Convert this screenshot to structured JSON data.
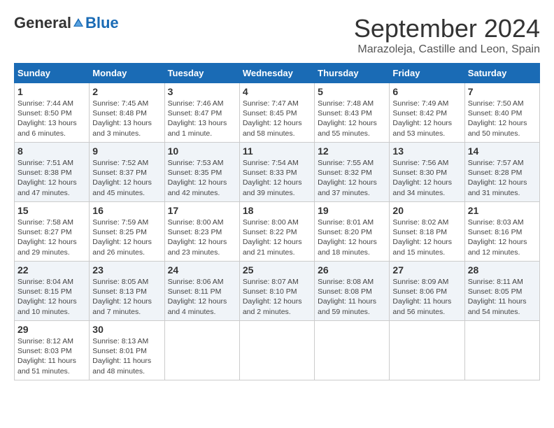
{
  "logo": {
    "general": "General",
    "blue": "Blue"
  },
  "header": {
    "month": "September 2024",
    "location": "Marazoleja, Castille and Leon, Spain"
  },
  "days_of_week": [
    "Sunday",
    "Monday",
    "Tuesday",
    "Wednesday",
    "Thursday",
    "Friday",
    "Saturday"
  ],
  "weeks": [
    [
      {
        "day": "1",
        "info": "Sunrise: 7:44 AM\nSunset: 8:50 PM\nDaylight: 13 hours\nand 6 minutes."
      },
      {
        "day": "2",
        "info": "Sunrise: 7:45 AM\nSunset: 8:48 PM\nDaylight: 13 hours\nand 3 minutes."
      },
      {
        "day": "3",
        "info": "Sunrise: 7:46 AM\nSunset: 8:47 PM\nDaylight: 13 hours\nand 1 minute."
      },
      {
        "day": "4",
        "info": "Sunrise: 7:47 AM\nSunset: 8:45 PM\nDaylight: 12 hours\nand 58 minutes."
      },
      {
        "day": "5",
        "info": "Sunrise: 7:48 AM\nSunset: 8:43 PM\nDaylight: 12 hours\nand 55 minutes."
      },
      {
        "day": "6",
        "info": "Sunrise: 7:49 AM\nSunset: 8:42 PM\nDaylight: 12 hours\nand 53 minutes."
      },
      {
        "day": "7",
        "info": "Sunrise: 7:50 AM\nSunset: 8:40 PM\nDaylight: 12 hours\nand 50 minutes."
      }
    ],
    [
      {
        "day": "8",
        "info": "Sunrise: 7:51 AM\nSunset: 8:38 PM\nDaylight: 12 hours\nand 47 minutes."
      },
      {
        "day": "9",
        "info": "Sunrise: 7:52 AM\nSunset: 8:37 PM\nDaylight: 12 hours\nand 45 minutes."
      },
      {
        "day": "10",
        "info": "Sunrise: 7:53 AM\nSunset: 8:35 PM\nDaylight: 12 hours\nand 42 minutes."
      },
      {
        "day": "11",
        "info": "Sunrise: 7:54 AM\nSunset: 8:33 PM\nDaylight: 12 hours\nand 39 minutes."
      },
      {
        "day": "12",
        "info": "Sunrise: 7:55 AM\nSunset: 8:32 PM\nDaylight: 12 hours\nand 37 minutes."
      },
      {
        "day": "13",
        "info": "Sunrise: 7:56 AM\nSunset: 8:30 PM\nDaylight: 12 hours\nand 34 minutes."
      },
      {
        "day": "14",
        "info": "Sunrise: 7:57 AM\nSunset: 8:28 PM\nDaylight: 12 hours\nand 31 minutes."
      }
    ],
    [
      {
        "day": "15",
        "info": "Sunrise: 7:58 AM\nSunset: 8:27 PM\nDaylight: 12 hours\nand 29 minutes."
      },
      {
        "day": "16",
        "info": "Sunrise: 7:59 AM\nSunset: 8:25 PM\nDaylight: 12 hours\nand 26 minutes."
      },
      {
        "day": "17",
        "info": "Sunrise: 8:00 AM\nSunset: 8:23 PM\nDaylight: 12 hours\nand 23 minutes."
      },
      {
        "day": "18",
        "info": "Sunrise: 8:00 AM\nSunset: 8:22 PM\nDaylight: 12 hours\nand 21 minutes."
      },
      {
        "day": "19",
        "info": "Sunrise: 8:01 AM\nSunset: 8:20 PM\nDaylight: 12 hours\nand 18 minutes."
      },
      {
        "day": "20",
        "info": "Sunrise: 8:02 AM\nSunset: 8:18 PM\nDaylight: 12 hours\nand 15 minutes."
      },
      {
        "day": "21",
        "info": "Sunrise: 8:03 AM\nSunset: 8:16 PM\nDaylight: 12 hours\nand 12 minutes."
      }
    ],
    [
      {
        "day": "22",
        "info": "Sunrise: 8:04 AM\nSunset: 8:15 PM\nDaylight: 12 hours\nand 10 minutes."
      },
      {
        "day": "23",
        "info": "Sunrise: 8:05 AM\nSunset: 8:13 PM\nDaylight: 12 hours\nand 7 minutes."
      },
      {
        "day": "24",
        "info": "Sunrise: 8:06 AM\nSunset: 8:11 PM\nDaylight: 12 hours\nand 4 minutes."
      },
      {
        "day": "25",
        "info": "Sunrise: 8:07 AM\nSunset: 8:10 PM\nDaylight: 12 hours\nand 2 minutes."
      },
      {
        "day": "26",
        "info": "Sunrise: 8:08 AM\nSunset: 8:08 PM\nDaylight: 11 hours\nand 59 minutes."
      },
      {
        "day": "27",
        "info": "Sunrise: 8:09 AM\nSunset: 8:06 PM\nDaylight: 11 hours\nand 56 minutes."
      },
      {
        "day": "28",
        "info": "Sunrise: 8:11 AM\nSunset: 8:05 PM\nDaylight: 11 hours\nand 54 minutes."
      }
    ],
    [
      {
        "day": "29",
        "info": "Sunrise: 8:12 AM\nSunset: 8:03 PM\nDaylight: 11 hours\nand 51 minutes."
      },
      {
        "day": "30",
        "info": "Sunrise: 8:13 AM\nSunset: 8:01 PM\nDaylight: 11 hours\nand 48 minutes."
      },
      {
        "day": "",
        "info": ""
      },
      {
        "day": "",
        "info": ""
      },
      {
        "day": "",
        "info": ""
      },
      {
        "day": "",
        "info": ""
      },
      {
        "day": "",
        "info": ""
      }
    ]
  ]
}
